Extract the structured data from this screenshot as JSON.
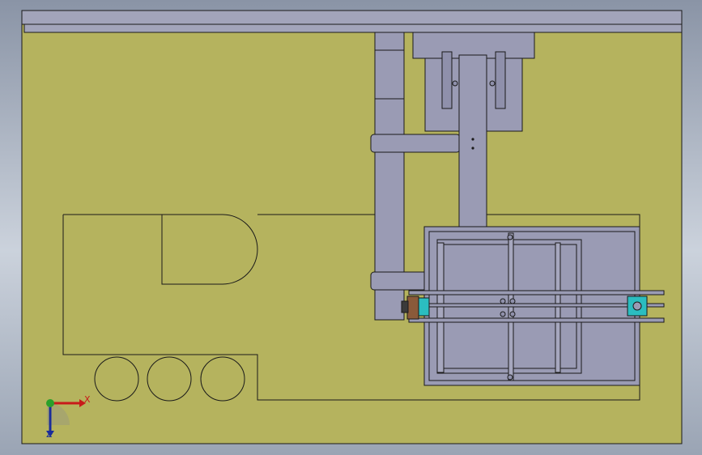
{
  "app": {
    "view": "Top",
    "document_type": "assembly"
  },
  "axes": {
    "x_label": "X",
    "z_label": "Z"
  },
  "colors": {
    "background": "#b5b35e",
    "steel": "#9a9bb4",
    "outline": "#1a1a1a",
    "accent_cyan": "#2bbdc0",
    "accent_brown": "#8a5a3a"
  },
  "icons": [
    "view-triad-icon"
  ]
}
